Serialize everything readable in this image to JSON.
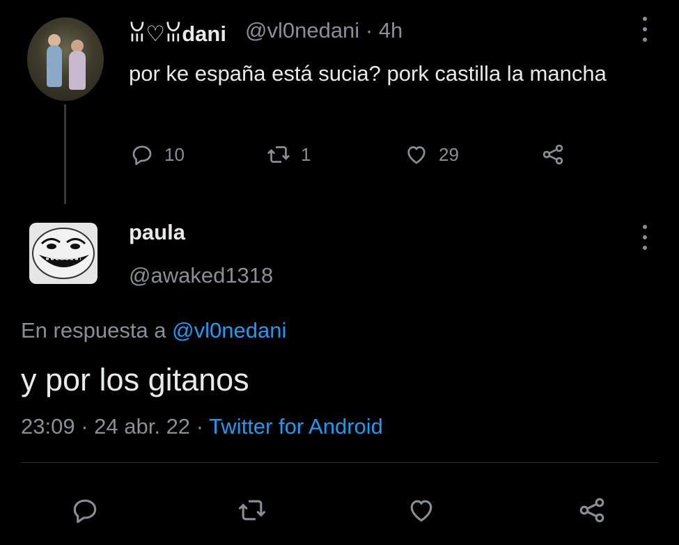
{
  "parent_tweet": {
    "display_name": "ꈍ♡ꈍdani",
    "handle": "@vl0nedani",
    "separator": "·",
    "time": "4h",
    "text": "por ke españa está sucia? pork castilla la mancha",
    "replies": "10",
    "retweets": "1",
    "likes": "29"
  },
  "main_tweet": {
    "display_name": "paula",
    "handle": "@awaked1318",
    "replying_prefix": "En respuesta a",
    "replying_to": "@vl0nedani",
    "text": "y por los gitanos",
    "time": "23:09",
    "date": "24 abr. 22",
    "separator": "·",
    "source": "Twitter for Android"
  },
  "colors": {
    "background": "#000000",
    "primary_text": "#e7e9ea",
    "secondary_text": "#8b8f93",
    "link": "#1d9bf0",
    "divider": "#2f3336"
  },
  "icons": {
    "reply": "reply-icon",
    "retweet": "retweet-icon",
    "like": "heart-icon",
    "share": "share-icon",
    "more": "more-vertical-icon"
  }
}
